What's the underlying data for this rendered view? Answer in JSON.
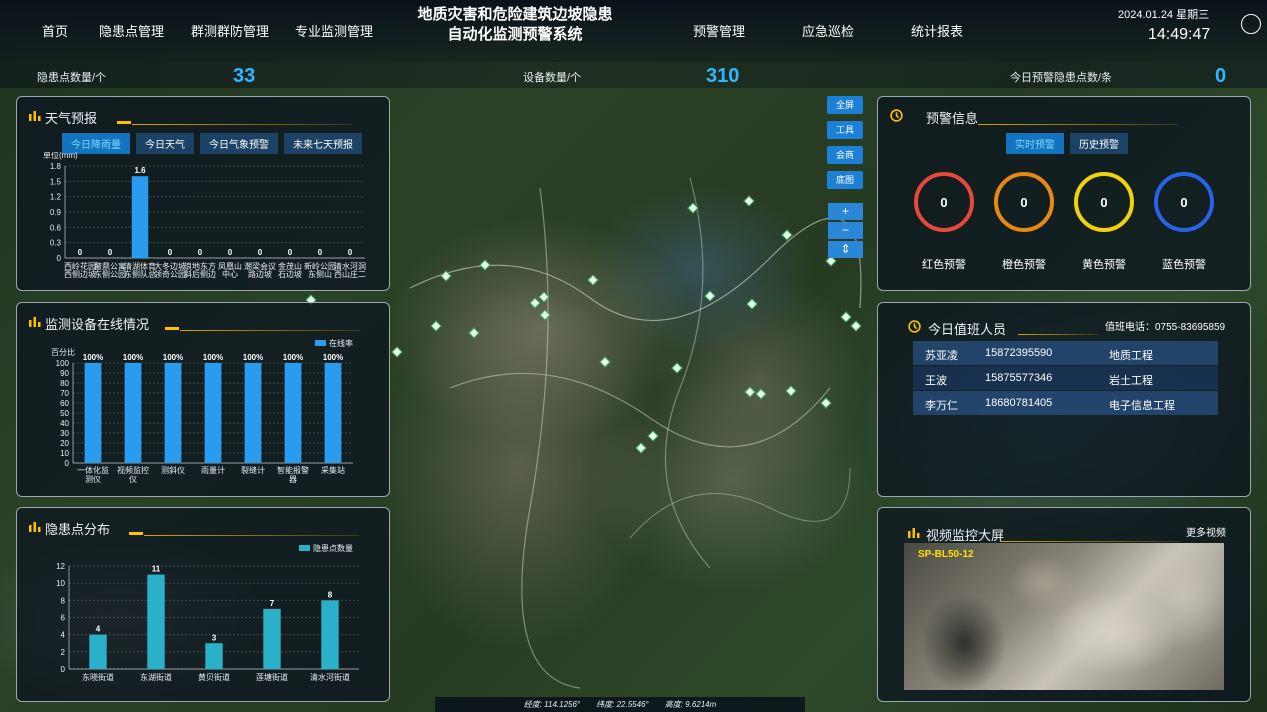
{
  "nav": {
    "left": [
      "首页",
      "隐患点管理",
      "群测群防管理",
      "专业监测管理"
    ],
    "right": [
      "预警管理",
      "应急巡检",
      "统计报表"
    ],
    "title_line1": "地质灾害和危险建筑边坡隐患",
    "title_line2": "自动化监测预警系统",
    "date": "2024.01.24 星期三",
    "time": "14:49:47"
  },
  "stats": [
    {
      "label": "隐患点数量/个",
      "value": "33"
    },
    {
      "label": "设备数量/个",
      "value": "310"
    },
    {
      "label": "今日预警隐患点数/条",
      "value": "0"
    }
  ],
  "weather": {
    "title": "天气预报",
    "tabs": [
      "今日降雨量",
      "今日天气",
      "今日气象预警",
      "未来七天预报"
    ],
    "active_tab": 0
  },
  "monitor": {
    "title": "监测设备在线情况"
  },
  "hazard": {
    "title": "隐患点分布"
  },
  "chart_data": [
    {
      "type": "bar",
      "title": "今日降雨量",
      "ylabel": "单位(mm)",
      "categories": [
        "西岭花园",
        "鳌鼎公寓",
        "清湖体育",
        "大冬边坡",
        "浪地东方",
        "凤凰山",
        "潮梁会议",
        "金茂山",
        "新岭公园",
        "清水河洞"
      ],
      "categories_line2": [
        "西侧边坡",
        "东侧公园",
        "东侧队总",
        "领奇公园",
        "斜后侧边",
        "中心",
        "路边坡",
        "石边坡",
        "东侧山",
        "西山庄二"
      ],
      "values": [
        0,
        0,
        1.6,
        0,
        0,
        0,
        0,
        0,
        0,
        0
      ],
      "ylim": [
        0,
        1.8
      ],
      "yticks": [
        0,
        0.3,
        0.6,
        0.9,
        1.2,
        1.5,
        1.8
      ]
    },
    {
      "type": "bar",
      "title": "监测设备在线情况",
      "ylabel": "百分比",
      "legend": "在线率",
      "categories": [
        "一体化监测仪",
        "视频监控仪",
        "测斜仪",
        "雨量计",
        "裂缝计",
        "智能报警器",
        "采集站"
      ],
      "values": [
        100,
        100,
        100,
        100,
        100,
        100,
        100
      ],
      "value_labels": [
        "100%",
        "100%",
        "100%",
        "100%",
        "100%",
        "100%",
        "100%"
      ],
      "ylim": [
        0,
        100
      ],
      "yticks": [
        0,
        10,
        20,
        30,
        40,
        50,
        60,
        70,
        80,
        90,
        100
      ]
    },
    {
      "type": "bar",
      "title": "隐患点分布",
      "legend": "隐患点数量",
      "categories": [
        "东晓街道",
        "东湖街道",
        "黄贝街道",
        "莲塘街道",
        "清水河街道"
      ],
      "values": [
        4,
        11,
        3,
        7,
        8
      ],
      "ylim": [
        0,
        12
      ],
      "yticks": [
        0,
        2,
        4,
        6,
        8,
        10,
        12
      ]
    }
  ],
  "map_controls": {
    "buttons": [
      "全屏",
      "工具",
      "会商",
      "底图"
    ],
    "zoom_in": "+",
    "zoom_out": "−",
    "compass": "⇕"
  },
  "warning": {
    "title": "预警信息",
    "tabs": [
      "实时预警",
      "历史预警"
    ],
    "levels": [
      {
        "label": "红色预警",
        "value": "0",
        "color": "#e8473c"
      },
      {
        "label": "橙色预警",
        "value": "0",
        "color": "#e88a12"
      },
      {
        "label": "黄色预警",
        "value": "0",
        "color": "#f2d20c"
      },
      {
        "label": "蓝色预警",
        "value": "0",
        "color": "#2a63e8"
      }
    ]
  },
  "duty": {
    "title": "今日值班人员",
    "phone": "值班电话：0755-83695859",
    "rows": [
      {
        "name": "苏亚凌",
        "phone": "15872395590",
        "dept": "地质工程"
      },
      {
        "name": "王波",
        "phone": "15875577346",
        "dept": "岩土工程"
      },
      {
        "name": "李万仁",
        "phone": "18680781405",
        "dept": "电子信息工程"
      }
    ]
  },
  "video": {
    "title": "视频监控大屏",
    "more": "更多视频",
    "camera_label": "SP-BL50-12"
  },
  "coords": {
    "lng": "经度: 114.1256°",
    "lat": "纬度: 22.5546°",
    "alt": "高度: 9.6214m"
  }
}
